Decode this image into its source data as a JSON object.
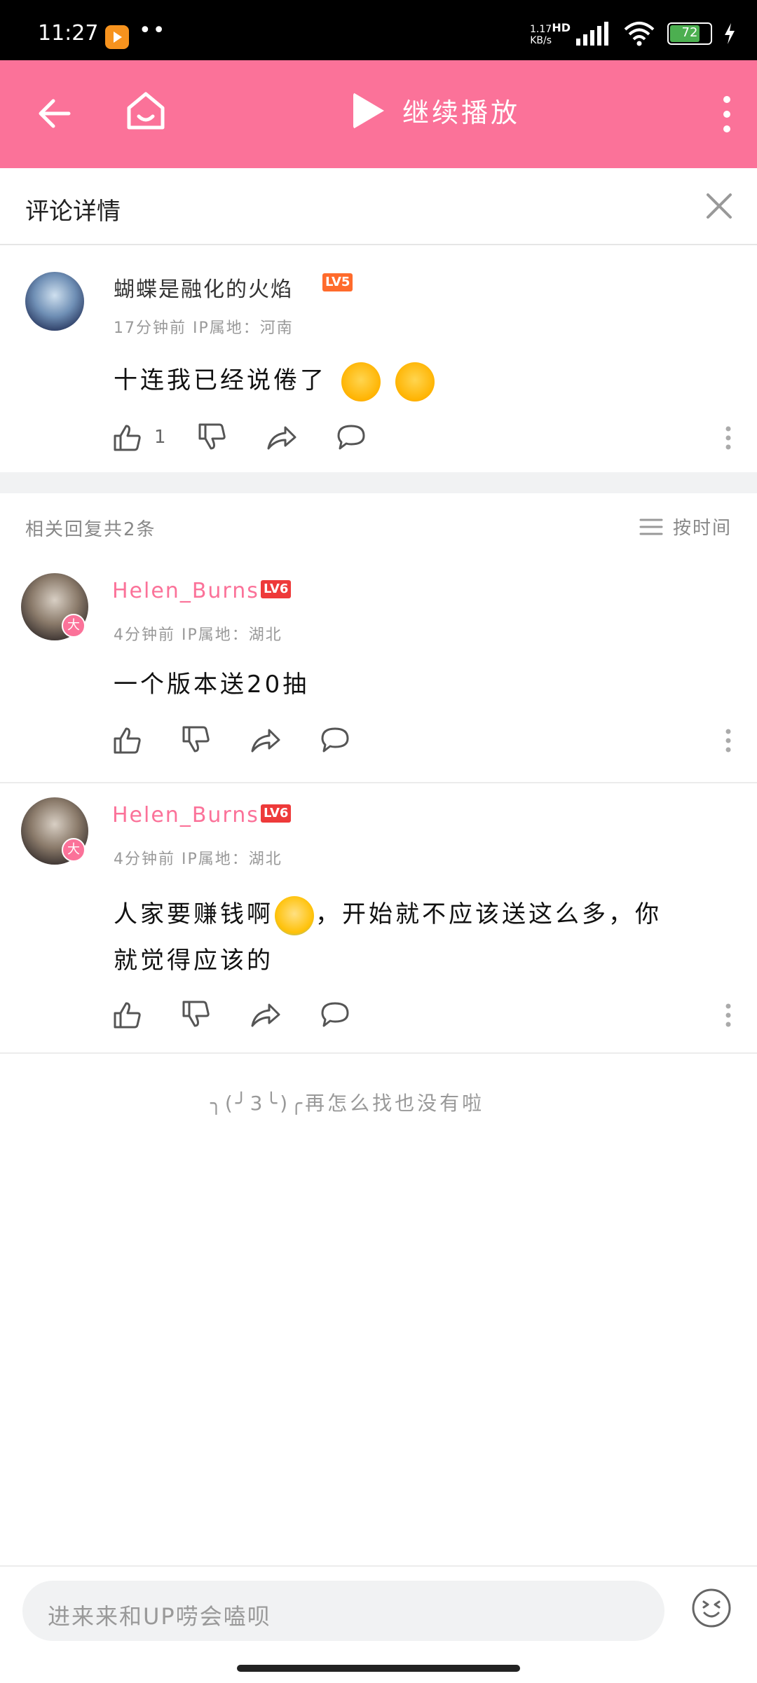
{
  "status_bar": {
    "time": "11:27",
    "dots": "••",
    "net_speed_value": "1.17",
    "net_speed_unit": "KB/s",
    "network_type": "HD",
    "battery": "72"
  },
  "topbar": {
    "continue_label": "继续播放",
    "accent_color": "#fb7299"
  },
  "detail_header": {
    "title": "评论详情"
  },
  "main_comment": {
    "username": "蝴蝶是融化的火焰",
    "level": "LV5",
    "meta": "17分钟前  IP属地：河南",
    "text": "十连我已经说倦了",
    "likes": "1"
  },
  "replies_header": {
    "count_text": "相关回复共2条",
    "sort_label": "按时间"
  },
  "replies": [
    {
      "username": "Helen_Burns",
      "level": "LV6",
      "badge": "大",
      "meta": "4分钟前  IP属地：湖北",
      "text": "一个版本送20抽"
    },
    {
      "username": "Helen_Burns",
      "level": "LV6",
      "badge": "大",
      "meta": "4分钟前  IP属地：湖北",
      "text_part1": "人家要赚钱啊",
      "text_part2": "，开始就不应该送这么多，你",
      "text_line2": "就觉得应该的"
    }
  ],
  "end_note": "╮(╯3╰)╭再怎么找也没有啦",
  "input": {
    "placeholder": "进来来和UP唠会嗑呗"
  }
}
